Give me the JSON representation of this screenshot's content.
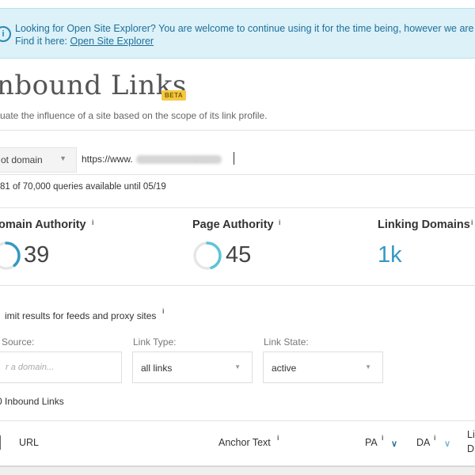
{
  "banner": {
    "text": "Looking for Open Site Explorer? You are welcome to continue using it for the time being, however we are",
    "find_prefix": "Find it here: ",
    "link": "Open Site Explorer"
  },
  "page": {
    "title": "nbound Links",
    "badge": "BETA",
    "subtitle": "uate the influence of a site based on the scope of its link profile."
  },
  "search": {
    "scope_value": "ot domain",
    "url_value": "https://www.                       com",
    "queries_text": "81 of 70,000 queries available until 05/19"
  },
  "metrics": [
    {
      "label": "omain Authority",
      "info": "i",
      "value": "39"
    },
    {
      "label": "Page Authority",
      "info": "i",
      "value": "45"
    },
    {
      "label": "Linking Domains",
      "info": "i",
      "value": "1k"
    }
  ],
  "filters": {
    "limit_label": "imit results for feeds and proxy sites",
    "limit_info": "i",
    "source_label": "Source:",
    "source_placeholder": "r a domain...",
    "link_type_label": "Link Type:",
    "link_type_value": "all links",
    "link_state_label": "Link State:",
    "link_state_value": "active"
  },
  "results": {
    "count_label": "0  Inbound Links"
  },
  "table": {
    "url": "URL",
    "anchor_text": "Anchor Text",
    "anchor_info": "i",
    "pa": "PA",
    "pa_info": "i",
    "da": "DA",
    "da_info": "i",
    "linking_domains_line1": "Li",
    "linking_domains_line2": "D"
  },
  "colors": {
    "banner_bg": "#dcf1f8",
    "accent": "#3598c4",
    "badge": "#f5c842",
    "ring_pa": "#5bc4d9"
  },
  "icons": [
    "info-circle-icon",
    "chevron-down-icon",
    "sort-chevron-icon"
  ]
}
